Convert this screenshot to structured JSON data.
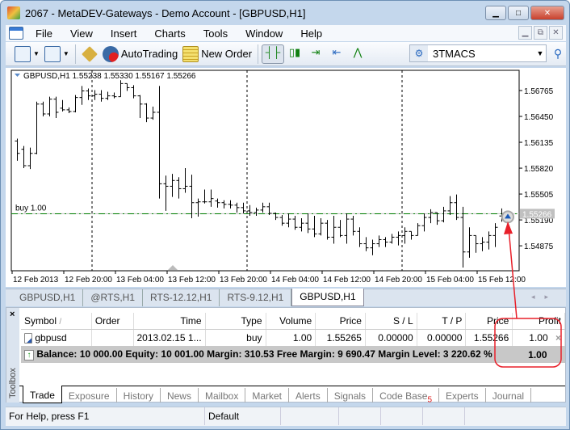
{
  "window": {
    "title": "2067 - MetaDEV-Gateways - Demo Account - [GBPUSD,H1]",
    "minimize": "▁",
    "maximize": "□",
    "close": "✕"
  },
  "menu": [
    "File",
    "View",
    "Insert",
    "Charts",
    "Tools",
    "Window",
    "Help"
  ],
  "toolbar": {
    "autotrading": "AutoTrading",
    "new_order": "New Order",
    "symbol_combo": "3TMACS"
  },
  "chart": {
    "header": "GBPUSD,H1  1.55238 1.55330 1.55167 1.55266",
    "trade_label": "buy 1.00",
    "bid_label": "1.55266",
    "colors": {
      "bars": "#000000",
      "trade_line": "#008000",
      "bid_line": "#c0c0c0",
      "annotation": "#e8202a"
    }
  },
  "chart_data": {
    "type": "ohlc",
    "symbol": "GBPUSD",
    "timeframe": "H1",
    "ylim": [
      1.54571,
      1.57011
    ],
    "y_ticks": [
      "1.56765",
      "1.56450",
      "1.56135",
      "1.55820",
      "1.55505",
      "1.55190",
      "1.54875"
    ],
    "x_ticks": [
      "12 Feb 2013",
      "12 Feb 20:00",
      "13 Feb 04:00",
      "13 Feb 12:00",
      "13 Feb 20:00",
      "14 Feb 04:00",
      "14 Feb 12:00",
      "14 Feb 20:00",
      "15 Feb 04:00",
      "15 Feb 12:00"
    ],
    "trade_level": 1.55265,
    "bid": 1.55266,
    "ohlc": [
      [
        1.5615,
        1.5618,
        1.5591,
        1.56
      ],
      [
        1.5605,
        1.5609,
        1.5582,
        1.5585
      ],
      [
        1.5585,
        1.5607,
        1.5581,
        1.56
      ],
      [
        1.56,
        1.5663,
        1.5599,
        1.566
      ],
      [
        1.566,
        1.5663,
        1.5645,
        1.5648
      ],
      [
        1.5648,
        1.5669,
        1.5645,
        1.5666
      ],
      [
        1.5666,
        1.5669,
        1.5643,
        1.565
      ],
      [
        1.5655,
        1.5665,
        1.5651,
        1.5653
      ],
      [
        1.5653,
        1.5656,
        1.5649,
        1.5651
      ],
      [
        1.5651,
        1.5671,
        1.565,
        1.5668
      ],
      [
        1.5668,
        1.5682,
        1.5659,
        1.5676
      ],
      [
        1.5676,
        1.5679,
        1.5665,
        1.567
      ],
      [
        1.567,
        1.5677,
        1.5665,
        1.5672
      ],
      [
        1.5672,
        1.5677,
        1.5663,
        1.5667
      ],
      [
        1.5667,
        1.5675,
        1.5665,
        1.567
      ],
      [
        1.567,
        1.5674,
        1.5667,
        1.5669
      ],
      [
        1.5669,
        1.5689,
        1.5669,
        1.5685
      ],
      [
        1.5685,
        1.5685,
        1.5676,
        1.568
      ],
      [
        1.568,
        1.5683,
        1.5667,
        1.567
      ],
      [
        1.567,
        1.5671,
        1.5643,
        1.566
      ],
      [
        1.566,
        1.5661,
        1.5638,
        1.5643
      ],
      [
        1.5643,
        1.5657,
        1.5641,
        1.565
      ],
      [
        1.565,
        1.5682,
        1.5545,
        1.5563
      ],
      [
        1.5563,
        1.5573,
        1.553,
        1.556
      ],
      [
        1.556,
        1.5575,
        1.5547,
        1.5567
      ],
      [
        1.5567,
        1.5571,
        1.5545,
        1.5557
      ],
      [
        1.5557,
        1.5582,
        1.5552,
        1.556
      ],
      [
        1.556,
        1.5574,
        1.5521,
        1.554
      ],
      [
        1.554,
        1.5545,
        1.5523,
        1.5541
      ],
      [
        1.5541,
        1.5556,
        1.5539,
        1.5541
      ],
      [
        1.5541,
        1.5556,
        1.5535,
        1.5545
      ],
      [
        1.5542,
        1.5545,
        1.5534,
        1.554
      ],
      [
        1.554,
        1.5543,
        1.5533,
        1.5538
      ],
      [
        1.5538,
        1.5543,
        1.5533,
        1.5537
      ],
      [
        1.5537,
        1.554,
        1.5528,
        1.5534
      ],
      [
        1.5534,
        1.554,
        1.5527,
        1.553
      ],
      [
        1.553,
        1.5537,
        1.5524,
        1.5528
      ],
      [
        1.5528,
        1.5534,
        1.5524,
        1.5531
      ],
      [
        1.5531,
        1.554,
        1.5528,
        1.5535
      ],
      [
        1.5535,
        1.554,
        1.5525,
        1.5527
      ],
      [
        1.5527,
        1.5528,
        1.5519,
        1.5522
      ],
      [
        1.5522,
        1.5525,
        1.5512,
        1.5515
      ],
      [
        1.5515,
        1.5527,
        1.551,
        1.552
      ],
      [
        1.552,
        1.5524,
        1.5507,
        1.551
      ],
      [
        1.551,
        1.5521,
        1.5505,
        1.5515
      ],
      [
        1.5515,
        1.5527,
        1.5503,
        1.5508
      ],
      [
        1.5508,
        1.5524,
        1.5498,
        1.5502
      ],
      [
        1.5502,
        1.5521,
        1.55,
        1.5515
      ],
      [
        1.5515,
        1.5519,
        1.5495,
        1.5498
      ],
      [
        1.5498,
        1.5524,
        1.549,
        1.551
      ],
      [
        1.551,
        1.5519,
        1.5498,
        1.55
      ],
      [
        1.55,
        1.5527,
        1.549,
        1.552
      ],
      [
        1.552,
        1.5524,
        1.55,
        1.5505
      ],
      [
        1.5505,
        1.551,
        1.5486,
        1.549
      ],
      [
        1.549,
        1.5498,
        1.5481,
        1.5485
      ],
      [
        1.5485,
        1.5495,
        1.5476,
        1.549
      ],
      [
        1.549,
        1.55,
        1.5486,
        1.5495
      ],
      [
        1.5495,
        1.5498,
        1.5486,
        1.5492
      ],
      [
        1.5492,
        1.5502,
        1.549,
        1.5498
      ],
      [
        1.5498,
        1.5505,
        1.5488,
        1.55
      ],
      [
        1.55,
        1.551,
        1.549,
        1.5505
      ],
      [
        1.5505,
        1.5505,
        1.5495,
        1.55
      ],
      [
        1.55,
        1.5515,
        1.55,
        1.5512
      ],
      [
        1.5512,
        1.5527,
        1.5505,
        1.5522
      ],
      [
        1.5522,
        1.5532,
        1.5515,
        1.5528
      ],
      [
        1.5528,
        1.5528,
        1.5513,
        1.5518
      ],
      [
        1.5518,
        1.5535,
        1.5516,
        1.553
      ],
      [
        1.553,
        1.5548,
        1.5525,
        1.554
      ],
      [
        1.554,
        1.555,
        1.5519,
        1.5522
      ],
      [
        1.5522,
        1.5535,
        1.5461,
        1.548
      ],
      [
        1.548,
        1.551,
        1.5473,
        1.55
      ],
      [
        1.55,
        1.55,
        1.5479,
        1.549
      ],
      [
        1.549,
        1.5498,
        1.5481,
        1.5492
      ],
      [
        1.5492,
        1.5505,
        1.5483,
        1.55
      ],
      [
        1.55,
        1.5515,
        1.5486,
        1.551
      ],
      [
        1.55238,
        1.5533,
        1.55167,
        1.55266
      ]
    ]
  },
  "chart_tabs": [
    "GBPUSD,H1",
    "@RTS,H1",
    "RTS-12.12,H1",
    "RTS-9.12,H1",
    "GBPUSD,H1"
  ],
  "toolbox": {
    "label": "Toolbox",
    "close": "×",
    "columns": [
      "Symbol",
      "Order",
      "Time",
      "Type",
      "Volume",
      "Price",
      "S / L",
      "T / P",
      "Price",
      "Profit"
    ],
    "rows": [
      {
        "symbol": "gbpusd",
        "order": "",
        "time": "2013.02.15 1...",
        "type": "buy",
        "volume": "1.00",
        "price": "1.55265",
        "sl": "0.00000",
        "tp": "0.00000",
        "cur_price": "1.55266",
        "profit": "1.00",
        "close": "×"
      }
    ],
    "summary": {
      "text": "Balance: 10 000.00  Equity: 10 001.00  Margin: 310.53  Free Margin: 9 690.47  Margin Level: 3 220.62 %",
      "profit": "1.00"
    },
    "tabs": [
      "Trade",
      "Exposure",
      "History",
      "News",
      "Mailbox",
      "Market",
      "Alerts",
      "Signals",
      "Code Base",
      "Experts",
      "Journal"
    ],
    "codebase_badge": "5"
  },
  "status": {
    "help": "For Help, press F1",
    "profile": "Default"
  }
}
